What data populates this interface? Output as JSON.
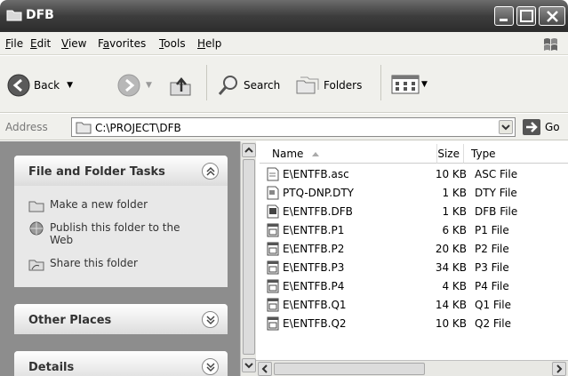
{
  "window": {
    "title": "DFB",
    "icon": "folder-icon"
  },
  "menu": {
    "items": [
      {
        "label": "File",
        "accel": "F"
      },
      {
        "label": "Edit",
        "accel": "E"
      },
      {
        "label": "View",
        "accel": "V"
      },
      {
        "label": "Favorites",
        "accel": "a"
      },
      {
        "label": "Tools",
        "accel": "T"
      },
      {
        "label": "Help",
        "accel": "H"
      }
    ]
  },
  "toolbar": {
    "back_label": "Back",
    "search_label": "Search",
    "folders_label": "Folders"
  },
  "address": {
    "label": "Address",
    "path": "C:\\PROJECT\\DFB",
    "go_label": "Go"
  },
  "tasks": {
    "file_folder": {
      "title": "File and Folder Tasks",
      "items": [
        {
          "label": "Make a new folder",
          "icon": "new-folder-icon"
        },
        {
          "label": "Publish this folder to the Web",
          "icon": "publish-web-icon"
        },
        {
          "label": "Share this folder",
          "icon": "share-folder-icon"
        }
      ]
    },
    "other_places": {
      "title": "Other Places"
    },
    "details": {
      "title": "Details"
    }
  },
  "filelist": {
    "columns": {
      "name": "Name",
      "size": "Size",
      "type": "Type"
    },
    "files": [
      {
        "name": "E\\ENTFB.asc",
        "size": "10 KB",
        "type": "ASC File",
        "icon": "text-file-icon"
      },
      {
        "name": "PTQ-DNP.DTY",
        "size": "1 KB",
        "type": "DTY File",
        "icon": "generic-file-icon"
      },
      {
        "name": "E\\ENTFB.DFB",
        "size": "1 KB",
        "type": "DFB File",
        "icon": "dfb-file-icon"
      },
      {
        "name": "E\\ENTFB.P1",
        "size": "6 KB",
        "type": "P1 File",
        "icon": "program-file-icon"
      },
      {
        "name": "E\\ENTFB.P2",
        "size": "20 KB",
        "type": "P2 File",
        "icon": "program-file-icon"
      },
      {
        "name": "E\\ENTFB.P3",
        "size": "34 KB",
        "type": "P3 File",
        "icon": "program-file-icon"
      },
      {
        "name": "E\\ENTFB.P4",
        "size": "4 KB",
        "type": "P4 File",
        "icon": "program-file-icon"
      },
      {
        "name": "E\\ENTFB.Q1",
        "size": "14 KB",
        "type": "Q1 File",
        "icon": "program-file-icon"
      },
      {
        "name": "E\\ENTFB.Q2",
        "size": "10 KB",
        "type": "Q2 File",
        "icon": "program-file-icon"
      }
    ]
  }
}
